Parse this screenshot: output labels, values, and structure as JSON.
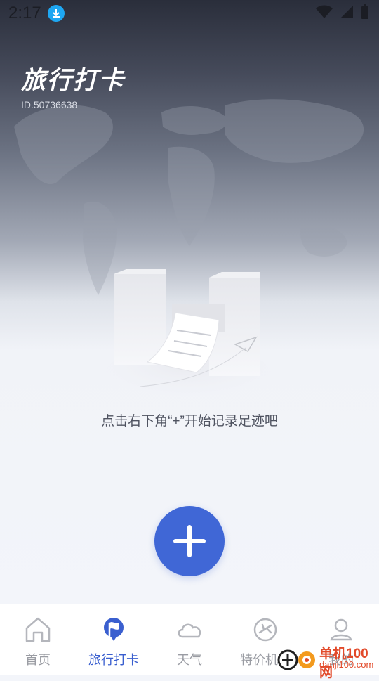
{
  "status_bar": {
    "time": "2:17",
    "icons": [
      "download-badge-icon",
      "wifi-icon",
      "signal-icon",
      "battery-icon"
    ]
  },
  "header": {
    "title": "旅行打卡",
    "user_id": "ID.50736638"
  },
  "empty_state": {
    "message": "点击右下角“+”开始记录足迹吧",
    "illustration": "buildings-ticket-paper-plane-illustration"
  },
  "fab": {
    "icon": "plus-icon"
  },
  "tabs": [
    {
      "label": "首页",
      "icon": "home-icon",
      "active": false
    },
    {
      "label": "旅行打卡",
      "icon": "flag-icon",
      "active": true
    },
    {
      "label": "天气",
      "icon": "cloud-icon",
      "active": false
    },
    {
      "label": "特价机票",
      "icon": "plane-icon",
      "active": false
    },
    {
      "label": "我的",
      "icon": "user-icon",
      "active": false
    }
  ],
  "watermark": {
    "line1": "单机100网",
    "line2": "danji100.com"
  },
  "colors": {
    "accent": "#4067d6",
    "active_tab": "#3a5fcf",
    "inactive_tab": "#9a9ca3"
  }
}
